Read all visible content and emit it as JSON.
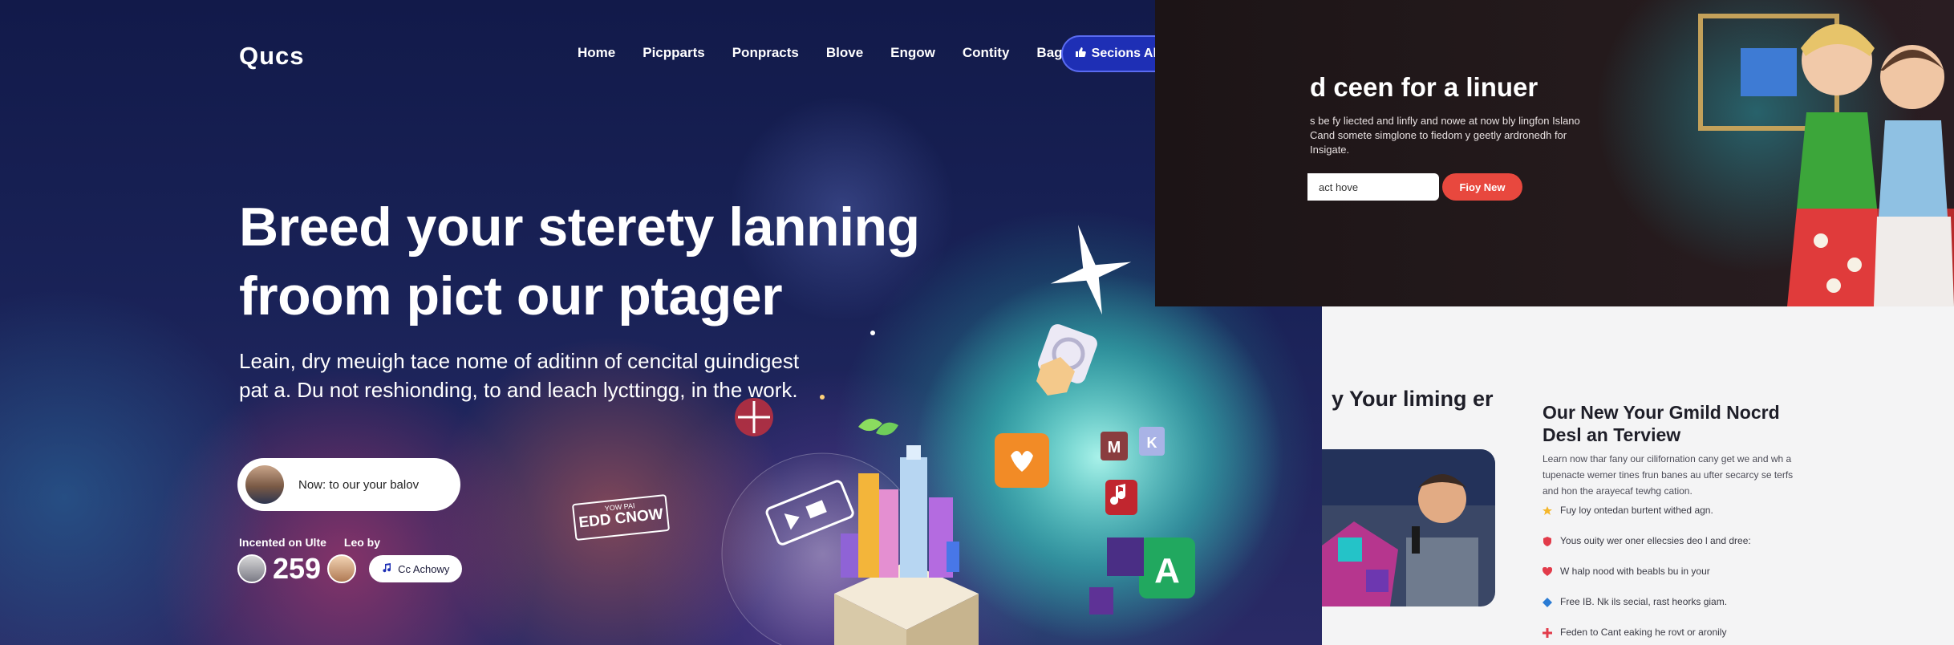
{
  "hero": {
    "logo": "Qucs",
    "nav": [
      "Home",
      "Picpparts",
      "Ponpracts",
      "Blove",
      "Engow",
      "Contity",
      "Bag"
    ],
    "nav_arrow": "↗",
    "cta_label": "Secions All",
    "headline_line1": "Breed your sterety lanning",
    "headline_line2": "froom pict our ptager",
    "subtitle_line1": "Leain, dry meuigh tace nome of aditinn of cencital guindigest",
    "subtitle_line2": "pat a. Du not reshionding, to and leach lycttingg, in the work.",
    "input_placeholder": "Now: to our your balov",
    "stat_label1": "Incented on Ulte",
    "stat_label2": "Leo by",
    "stat_value": "259",
    "small_pill": "Cc Achowy",
    "badge_small": "YOW PAI",
    "badge_big": "EDD CNOW"
  },
  "right_top": {
    "heading": "d ceen for a linuer",
    "paragraph": "s be fy liected and linfly and nowe at now bly lingfon Islano Cand somete simglone to fiedom y geetly ardronedh for Insigate.",
    "input_placeholder": "act hove",
    "button_label": "Fioy New"
  },
  "right_bottom": {
    "heading": "y Your liming er",
    "card_title": "Our New Your Gmild Nocrd Desl an Terview",
    "card_desc": "Learn now thar fany our cilifornation cany get we and wh a tupenacte wemer tines frun banes au ufter secarcy se terfs and hon the arayecaf tewhg cation.",
    "list": [
      "Fuy loy ontedan burtent withed agn.",
      "Yous ouity wer oner ellecsies deo l and dree:",
      "W halp nood with beabls bu in your",
      "Free IB. Nk ils secial, rast heorks giam.",
      "Feden to Cant eaking he rovt or aronily"
    ],
    "list_colors": [
      "#f4b62a",
      "#e23b4a",
      "#e23b4a",
      "#2a7bd4",
      "#e23b4a"
    ]
  }
}
